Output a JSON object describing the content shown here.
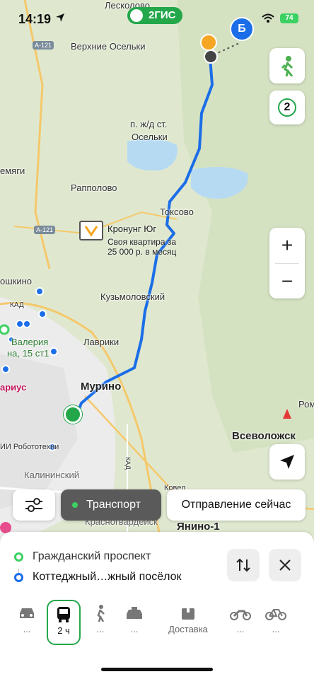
{
  "status": {
    "time": "14:19",
    "battery": "74"
  },
  "brand": "2ГИС",
  "map": {
    "labels": {
      "leskolovo": "Лесколово",
      "verkhnie_oselki": "Верхние Осельки",
      "pzhd_oselki_1": "п. ж/д ст.",
      "pzhd_oselki_2": "Осельки",
      "vemyagi": "емяги",
      "rappolovo": "Рапполово",
      "toksovo": "Токсово",
      "kuzmolovsky": "Кузьмоловский",
      "oshkino": "ошкино",
      "kad": "КАД",
      "lavriki": "Лаврики",
      "valeria": "Валерия",
      "valeria_addr": "на, 15 ст1",
      "arius": "ариус",
      "murino": "Мурино",
      "robototekhniki": "ИИ Робототехни",
      "vsevolozhsk": "Всеволожск",
      "kalininsky": "Калининский",
      "kad_vertical": "КАД",
      "koved": "Ковед",
      "krasnogvardeysky": "Красногвардейск",
      "yanino": "Янино-1",
      "rom": "Ром"
    },
    "road_badges": {
      "a121_top": "А-121",
      "a121_mid": "А-121"
    },
    "ad": {
      "title": "Кронунг Юг",
      "text": "Своя квартира за 25 000 р. в месяц"
    },
    "pin_b": "Б"
  },
  "controls": {
    "layers_count": "2",
    "zoom_in": "+",
    "zoom_out": "−"
  },
  "chips": {
    "transport": "Транспорт",
    "departure": "Отправление сейчас"
  },
  "route": {
    "from": "Гражданский проспект",
    "to": "Коттеджный…жный посёлок"
  },
  "modes": [
    {
      "name": "car",
      "value": "..."
    },
    {
      "name": "transit",
      "value": "2 ч"
    },
    {
      "name": "walk",
      "value": "..."
    },
    {
      "name": "taxi",
      "value": "..."
    },
    {
      "name": "delivery",
      "value": "Доставка"
    },
    {
      "name": "moto",
      "value": "..."
    },
    {
      "name": "bike",
      "value": "..."
    }
  ],
  "colors": {
    "accent": "#23a74a",
    "route": "#1b6ee8",
    "to_ring": "#1b6ee8",
    "from_ring": "#3bd163"
  }
}
